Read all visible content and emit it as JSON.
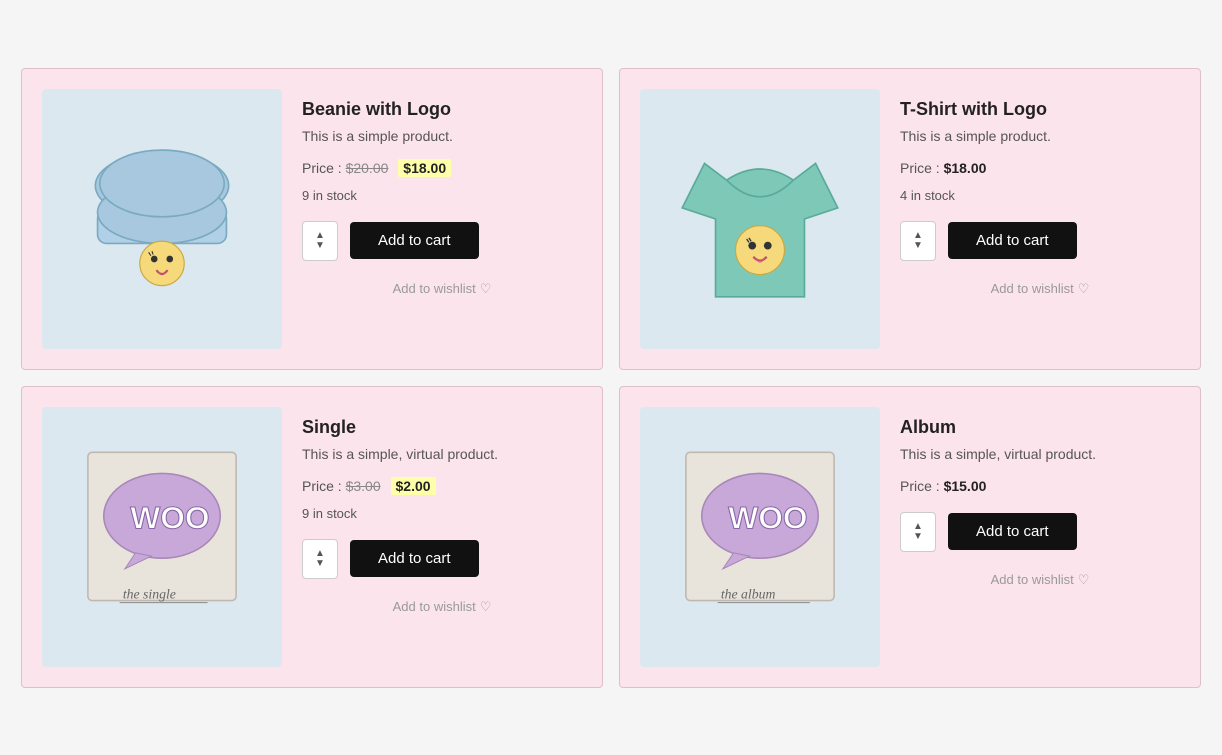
{
  "products": [
    {
      "id": "beanie-with-logo",
      "name": "Beanie with Logo",
      "description": "This is a simple product.",
      "price_label": "Price :",
      "original_price": "$20.00",
      "sale_price": "$18.00",
      "has_sale": true,
      "stock": "9 in stock",
      "add_to_cart_label": "Add to cart",
      "wishlist_label": "Add to wishlist",
      "image_type": "beanie"
    },
    {
      "id": "tshirt-with-logo",
      "name": "T-Shirt with Logo",
      "description": "This is a simple product.",
      "price_label": "Price :",
      "original_price": null,
      "sale_price": "$18.00",
      "has_sale": false,
      "stock": "4 in stock",
      "add_to_cart_label": "Add to cart",
      "wishlist_label": "Add to wishlist",
      "image_type": "tshirt"
    },
    {
      "id": "single",
      "name": "Single",
      "description": "This is a simple, virtual product.",
      "price_label": "Price :",
      "original_price": "$3.00",
      "sale_price": "$2.00",
      "has_sale": true,
      "stock": "9 in stock",
      "add_to_cart_label": "Add to cart",
      "wishlist_label": "Add to wishlist",
      "image_type": "woo-single"
    },
    {
      "id": "album",
      "name": "Album",
      "description": "This is a simple, virtual product.",
      "price_label": "Price :",
      "original_price": null,
      "sale_price": "$15.00",
      "has_sale": false,
      "stock": null,
      "add_to_cart_label": "Add to cart",
      "wishlist_label": "Add to wishlist",
      "image_type": "woo-album"
    }
  ],
  "heart_icon": "♡"
}
